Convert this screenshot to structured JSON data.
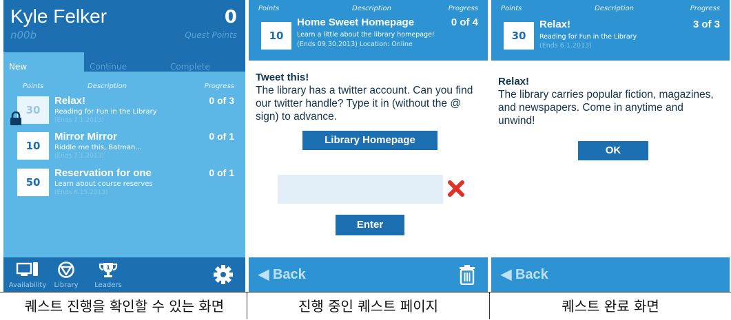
{
  "panel1": {
    "user_name": "Kyle Felker",
    "rank": "n00b",
    "quest_points_value": "0",
    "quest_points_label": "Quest Points",
    "tabs": [
      {
        "label": "New",
        "active": true
      },
      {
        "label": "Continue",
        "active": false
      },
      {
        "label": "Complete",
        "active": false
      }
    ],
    "columns": {
      "points": "Points",
      "description": "Description",
      "progress": "Progress"
    },
    "quests": [
      {
        "points": "30",
        "title": "Relax!",
        "desc": "Reading for Fun in the Library",
        "ends": "(Ends 7.1.2013)",
        "progress": "0 of 3",
        "locked": true
      },
      {
        "points": "10",
        "title": "Mirror Mirror",
        "desc": "Riddle me this, Batman...",
        "ends": "(Ends 7.1.2013)",
        "progress": "0 of 1",
        "locked": false
      },
      {
        "points": "50",
        "title": "Reservation for one",
        "desc": "Learn about course reserves",
        "ends": "(Ends 6.15.2013)",
        "progress": "0 of 1",
        "locked": false
      }
    ],
    "nav": [
      {
        "label": "Availability",
        "icon": "monitor-phone-icon"
      },
      {
        "label": "Library",
        "icon": "library-logo-icon"
      },
      {
        "label": "Leaders",
        "icon": "trophy-icon"
      }
    ],
    "settings_icon": "gear-icon"
  },
  "panel2": {
    "columns": {
      "points": "Points",
      "description": "Description",
      "progress": "Progress"
    },
    "quest": {
      "points": "10",
      "title": "Home Sweet Homepage",
      "desc": "Learn a little about the library homepage!",
      "ends": "(Ends 09.30.2013)  Location: Online",
      "progress": "0 of 4"
    },
    "task_title": "Tweet this!",
    "task_text": "The library has a twitter account.  Can you find our twitter handle? Type it in (without the @ sign) to advance.",
    "homepage_button": "Library Homepage",
    "answer_value": "",
    "answer_placeholder": "",
    "enter_button": "Enter",
    "back_label": "Back",
    "trash_icon": "trash-icon",
    "clear_icon": "x-mark-icon"
  },
  "panel3": {
    "columns": {
      "points": "Points",
      "description": "Description",
      "progress": "Progress"
    },
    "quest": {
      "points": "30",
      "title": "Relax!",
      "desc": "Reading for Fun in the Library",
      "ends": "(Ends 6.1.2013)",
      "progress": "3 of 3"
    },
    "message_title": "Relax!",
    "message_text": "The library carries popular fiction, magazines, and newspapers.  Come in anytime and unwind!",
    "ok_button": "OK",
    "back_label": "Back"
  },
  "captions": [
    "퀘스트 진행을 확인할 수 있는 화면",
    "진행 중인 퀘스트 페이지",
    "퀘스트 완료 화면"
  ],
  "colors": {
    "dark_blue": "#1c6fb0",
    "header_blue": "#2e93d2",
    "list_blue": "#5db7e6",
    "text_navy": "#10334d",
    "error_red": "#e0312b"
  }
}
